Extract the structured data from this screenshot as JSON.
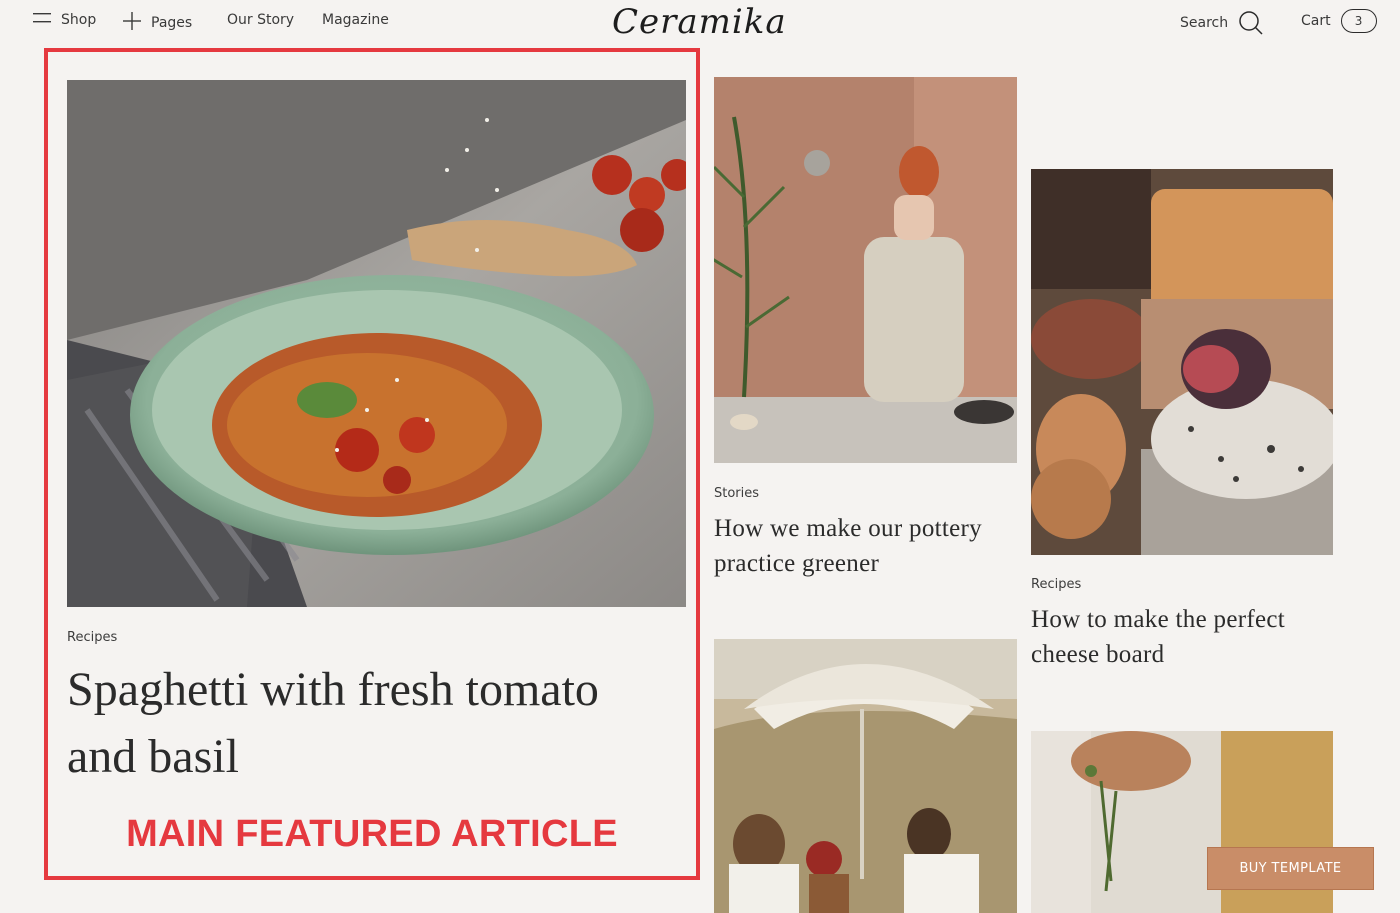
{
  "header": {
    "menu_label": "Shop",
    "pages_label": "Pages",
    "story_label": "Our Story",
    "magazine_label": "Magazine",
    "logo": "Ceramika",
    "search_label": "Search",
    "cart_label": "Cart",
    "cart_count": "3"
  },
  "featured": {
    "category": "Recipes",
    "title_line1": "Spaghetti with fresh tomato",
    "title_line2": "and basil",
    "annotation": "MAIN FEATURED ARTICLE"
  },
  "articles": [
    {
      "category": "Stories",
      "title_line1": "How we make our pottery",
      "title_line2": "practice greener"
    },
    {
      "category": "Recipes",
      "title_line1": "How to make the perfect",
      "title_line2": "cheese board"
    }
  ],
  "buy_button": "BUY TEMPLATE",
  "colors": {
    "annotation": "#e5393f",
    "button": "#c98d68",
    "background": "#f5f3f1"
  },
  "icons": [
    "hamburger-icon",
    "plus-icon",
    "search-icon"
  ]
}
